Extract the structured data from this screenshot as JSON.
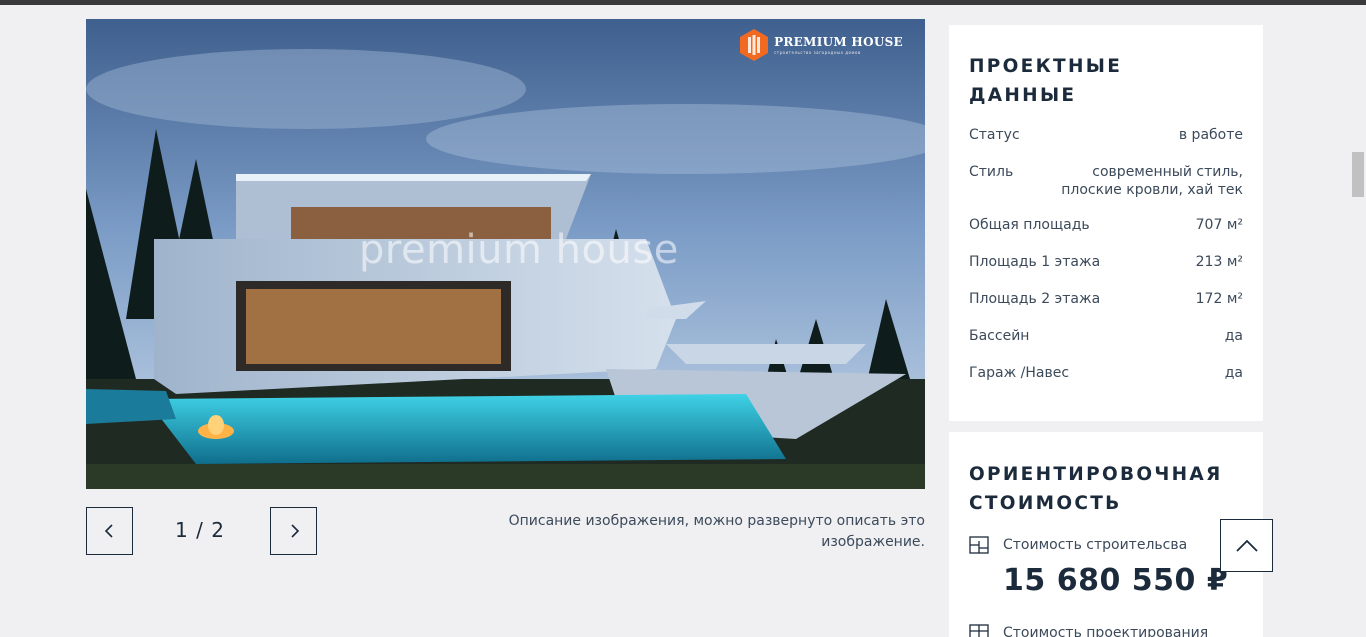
{
  "gallery": {
    "logo_text": "PREMIUM HOUSE",
    "logo_subtext": "строительство загородных домов",
    "watermark": "premium house",
    "counter": "1 / 2",
    "caption": "Описание изображения, можно развернуто описать это изображение.",
    "prev_icon": "chevron-left-icon",
    "next_icon": "chevron-right-icon"
  },
  "project_data": {
    "title": "ПРОЕКТНЫЕ ДАННЫЕ",
    "rows": [
      {
        "label": "Статус",
        "value": "в работе"
      },
      {
        "label": "Стиль",
        "value": "современный стиль, плоские кровли, хай тек"
      },
      {
        "label": "Общая площадь",
        "value": "707 м²"
      },
      {
        "label": "Площадь 1 этажа",
        "value": "213 м²"
      },
      {
        "label": "Площадь 2 этажа",
        "value": "172 м²"
      },
      {
        "label": "Бассейн",
        "value": "да"
      },
      {
        "label": "Гараж /Навес",
        "value": "да"
      }
    ]
  },
  "cost": {
    "title": "ОРИЕНТИРОВОЧНАЯ СТОИМОСТЬ",
    "construction_label": "Стоимость строительсва",
    "construction_value": "15 680 550 ₽",
    "design_label": "Стоимость проектирования"
  },
  "colors": {
    "accent": "#1c2b3c",
    "background": "#f0f0f3",
    "logo_orange": "#f26a21"
  },
  "to_top_icon": "chevron-up-icon"
}
